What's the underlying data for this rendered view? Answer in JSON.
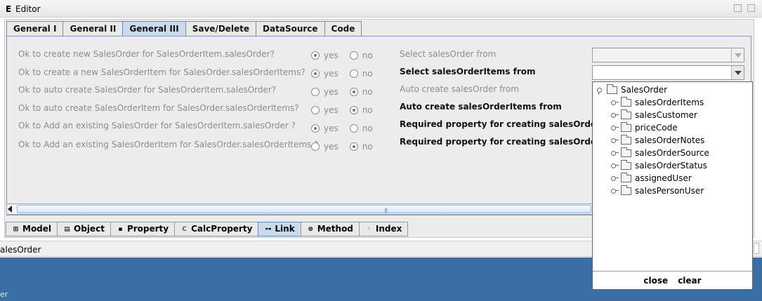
{
  "window": {
    "title_glyph": "E",
    "title": "Editor"
  },
  "top_tabs": [
    "General I",
    "General II",
    "General III",
    "Save/Delete",
    "DataSource",
    "Code"
  ],
  "questions": [
    {
      "text": "Ok to create new SalesOrder for SalesOrderItem.salesOrder?",
      "selected": "yes"
    },
    {
      "text": "Ok to create a new SalesOrderItem for SalesOrder.salesOrderItems?",
      "selected": "yes"
    },
    {
      "text": "Ok to auto create SalesOrder for SalesOrderItem.salesOrder?",
      "selected": "no"
    },
    {
      "text": "Ok to auto create SalesOrderItem for SalesOrder.salesOrderItems?",
      "selected": "no"
    },
    {
      "text": "Ok to Add an existing SalesOrder for SalesOrderItem.salesOrder ?",
      "selected": "yes"
    },
    {
      "text": "Ok to Add an existing SalesOrderItem for SalesOrder.salesOrderItems ?",
      "selected": "no"
    }
  ],
  "radio_labels": {
    "yes": "yes",
    "no": "no"
  },
  "right_labels": [
    {
      "text": "Select salesOrder from",
      "style": "dim"
    },
    {
      "text": "Select salesOrderItems from",
      "style": "bold"
    },
    {
      "text": "Auto create salesOrder from",
      "style": "dim"
    },
    {
      "text": "Auto create salesOrderItems from",
      "style": "bold"
    },
    {
      "text": "Required property for creating salesOrder",
      "style": "bold"
    },
    {
      "text": "Required property for creating salesOrderItems",
      "style": "bold"
    }
  ],
  "bottom_tabs": [
    {
      "label": "Model",
      "icon": "model-icon"
    },
    {
      "label": "Object",
      "icon": "object-icon"
    },
    {
      "label": "Property",
      "icon": "property-icon"
    },
    {
      "label": "CalcProperty",
      "icon": "calc-property-icon"
    },
    {
      "label": "Link",
      "icon": "link-icon"
    },
    {
      "label": "Method",
      "icon": "method-icon"
    },
    {
      "label": "Index",
      "icon": "index-icon"
    }
  ],
  "status": {
    "text": "alesOrder"
  },
  "desktop": {
    "text": "er"
  },
  "tree_popup": {
    "root": "SalesOrder",
    "children": [
      "salesOrderItems",
      "salesCustomer",
      "priceCode",
      "salesOrderNotes",
      "salesOrderSource",
      "salesOrderStatus",
      "assignedUser",
      "salesPersonUser"
    ],
    "close_label": "close",
    "clear_label": "clear"
  }
}
